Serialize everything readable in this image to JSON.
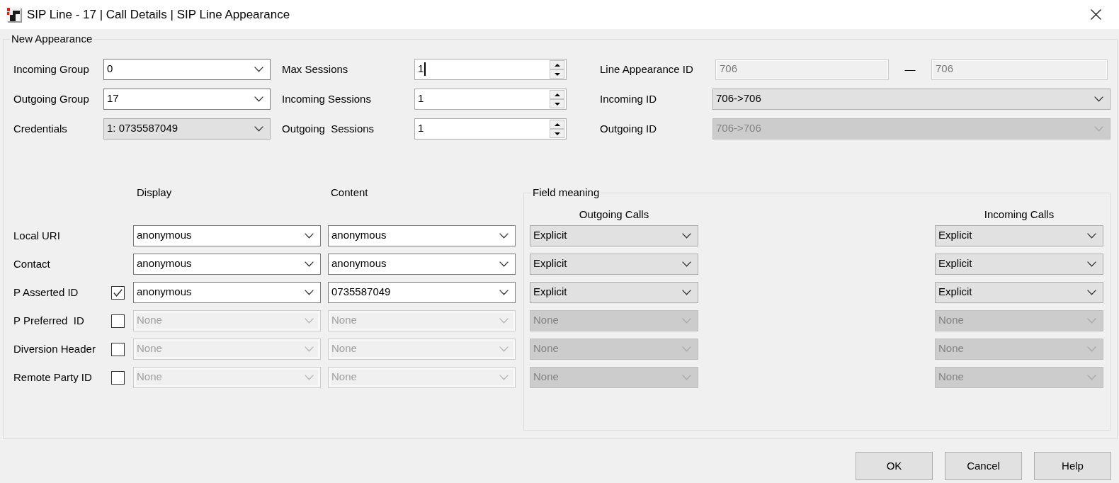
{
  "window": {
    "title": "SIP Line - 17 | Call Details | SIP Line Appearance"
  },
  "new_appearance": {
    "title": "New Appearance",
    "groups": [
      {
        "label": "Incoming Group",
        "kind": "editable",
        "value": "0"
      },
      {
        "label": "Outgoing Group",
        "kind": "editable",
        "value": "17"
      },
      {
        "label": "Credentials",
        "kind": "list",
        "value": "1: 0735587049"
      }
    ],
    "sessions": [
      {
        "label": "Max Sessions",
        "value": "1",
        "focused": true
      },
      {
        "label": "Incoming Sessions",
        "value": "1",
        "focused": false
      },
      {
        "label": "Outgoing  Sessions",
        "value": "1",
        "focused": false
      }
    ],
    "ids": [
      {
        "label": "Line Appearance ID",
        "kind": "range",
        "values": [
          "706",
          "706"
        ],
        "separator": "—",
        "disabled": true
      },
      {
        "label": "Incoming ID",
        "kind": "list",
        "value": "706->706",
        "disabled": false
      },
      {
        "label": "Outgoing ID",
        "kind": "list",
        "value": "706->706",
        "disabled": true
      }
    ],
    "headers": [
      "Display",
      "Content"
    ],
    "field_meaning": {
      "title": "Field meaning",
      "columns": [
        "Outgoing Calls",
        "Incoming Calls"
      ]
    },
    "rows": [
      {
        "label": "Local URI",
        "kind": "fixed",
        "disabled": false,
        "display": "anonymous",
        "content": "anonymous",
        "outgoing": "Explicit",
        "incoming": "Explicit"
      },
      {
        "label": "Contact",
        "kind": "fixed",
        "disabled": false,
        "display": "anonymous",
        "content": "anonymous",
        "outgoing": "Explicit",
        "incoming": "Explicit"
      },
      {
        "label": "P Asserted ID",
        "kind": "optional",
        "checked": true,
        "disabled": false,
        "display": "anonymous",
        "content": "0735587049",
        "outgoing": "Explicit",
        "incoming": "Explicit"
      },
      {
        "label": "P Preferred  ID",
        "kind": "optional",
        "checked": false,
        "disabled": true,
        "display": "None",
        "content": "None",
        "outgoing": "None",
        "incoming": "None"
      },
      {
        "label": "Diversion Header",
        "kind": "optional",
        "checked": false,
        "disabled": true,
        "display": "None",
        "content": "None",
        "outgoing": "None",
        "incoming": "None"
      },
      {
        "label": "Remote Party ID",
        "kind": "optional",
        "checked": false,
        "disabled": true,
        "display": "None",
        "content": "None",
        "outgoing": "None",
        "incoming": "None"
      }
    ]
  },
  "buttons": [
    "OK",
    "Cancel",
    "Help"
  ]
}
